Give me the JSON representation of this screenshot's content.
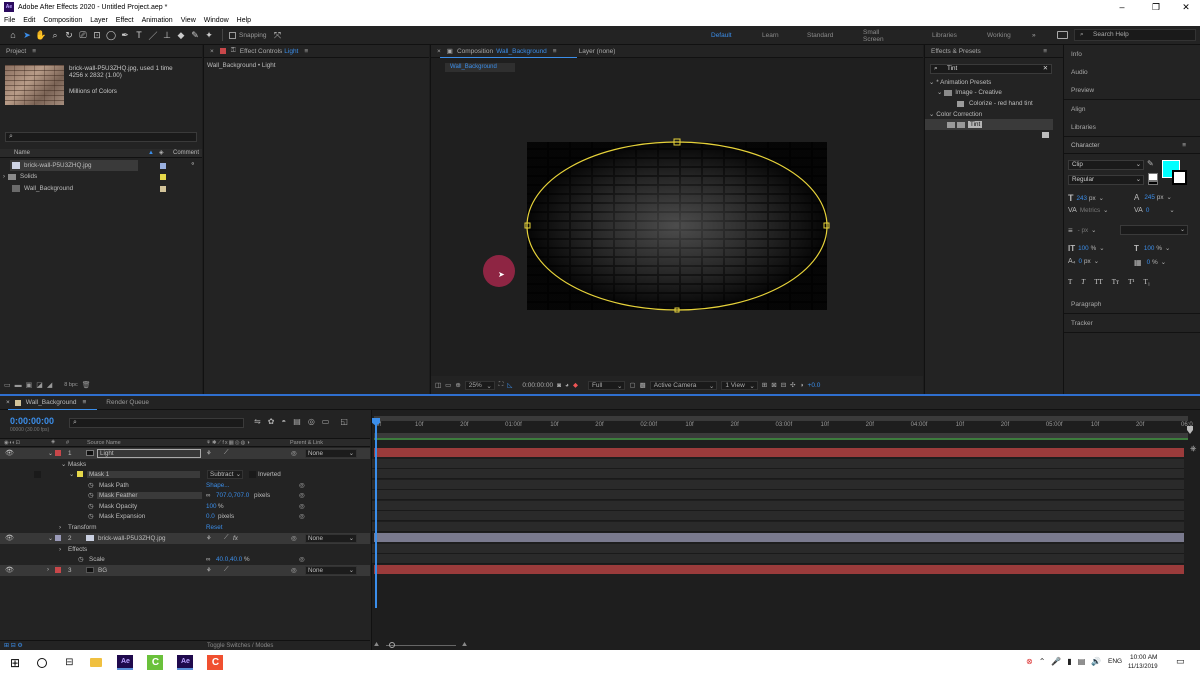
{
  "window": {
    "title": "Adobe After Effects 2020 - Untitled Project.aep *",
    "app_icon": "Ae"
  },
  "menu": [
    "File",
    "Edit",
    "Composition",
    "Layer",
    "Effect",
    "Animation",
    "View",
    "Window",
    "Help"
  ],
  "toolbar": {
    "snapping": "Snapping"
  },
  "workspaces": {
    "items": [
      "Default",
      "Learn",
      "Standard",
      "Small Screen",
      "Libraries",
      "Working"
    ],
    "active": "Default",
    "search_help": "Search Help"
  },
  "project": {
    "title": "Project",
    "thumb_name": "brick-wall-P5U3ZHQ.jpg",
    "thumb_used": ", used 1 time",
    "thumb_dims": "4256 x 2832 (1.00)",
    "thumb_colors": "Millions of Colors",
    "col_name": "Name",
    "col_comment": "Comment",
    "items": [
      {
        "name": "brick-wall-P5U3ZHQ.jpg",
        "color": "#9ab0e0"
      },
      {
        "name": "Solids",
        "color": "#e6d84a"
      },
      {
        "name": "Wall_Background",
        "color": "#d3c49a"
      }
    ],
    "bpc": "8 bpc"
  },
  "effect_controls": {
    "tab_prefix": "Effect Controls",
    "tab_layer": "Light",
    "path": "Wall_Background • Light"
  },
  "composition": {
    "tab_prefix": "Composition",
    "tab_name": "Wall_Background",
    "layer_tab": "Layer (none)",
    "sub_tab": "Wall_Background",
    "zoom": "25%",
    "time": "0:00:00:00",
    "resolution": "Full",
    "camera": "Active Camera",
    "views": "1 View",
    "exposure": "+0.0"
  },
  "effects_presets": {
    "title": "Effects & Presets",
    "search": "Tint",
    "tree": [
      {
        "label": "* Animation Presets",
        "level": 0
      },
      {
        "label": "Image - Creative",
        "level": 1
      },
      {
        "label": "Colorize - red hand tint",
        "level": 2
      },
      {
        "label": "Color Correction",
        "level": 0
      },
      {
        "label": "Tint",
        "level": 1
      }
    ]
  },
  "right_panels": {
    "info": "Info",
    "audio": "Audio",
    "preview": "Preview",
    "align": "Align",
    "libraries": "Libraries",
    "paragraph": "Paragraph",
    "tracker": "Tracker"
  },
  "character": {
    "title": "Character",
    "font": "Clip",
    "style": "Regular",
    "size": "243",
    "size_unit": "px",
    "leading": "245",
    "leading_unit": "px",
    "kerning": "Metrics",
    "tracking": "0",
    "stroke": "- px",
    "vscale": "100",
    "hscale": "100",
    "percent": "%",
    "baseline": "0",
    "baseline_unit": "px",
    "tsume": "0",
    "fill_color": "#00ffff",
    "format_buttons": [
      "T",
      "T",
      "TT",
      "Tт",
      "T¹",
      "T₁"
    ]
  },
  "timeline": {
    "comp_tab": "Wall_Background",
    "render_queue": "Render Queue",
    "time": "0:00:00:00",
    "time_sub": "00000 (30.00 fps)",
    "col_source": "Source Name",
    "col_parent": "Parent & Link",
    "toggle": "Toggle Switches / Modes",
    "ruler": [
      "0f",
      "10f",
      "20f",
      "01:00f",
      "10f",
      "20f",
      "02:00f",
      "10f",
      "20f",
      "03:00f",
      "10f",
      "20f",
      "04:00f",
      "10f",
      "20f",
      "05:00f",
      "10f",
      "20f",
      "06:0"
    ],
    "layers": [
      {
        "num": "1",
        "name": "Light",
        "color": "#c8474a",
        "bar": "#9b3b3b",
        "parent": "None"
      },
      {
        "num": "2",
        "name": "brick-wall-P5U3ZHQ.jpg",
        "color": "#9a9ab8",
        "bar": "#7a7a8e",
        "parent": "None"
      },
      {
        "num": "3",
        "name": "BG",
        "color": "#c8474a",
        "bar": "#9b3b3b",
        "parent": "None"
      }
    ],
    "masks_label": "Masks",
    "mask1": "Mask 1",
    "mask_mode": "Subtract",
    "inverted": "Inverted",
    "mask_path": "Mask Path",
    "mask_path_val": "Shape...",
    "mask_feather": "Mask Feather",
    "mask_feather_val": "707.0,707.0",
    "pixels": "pixels",
    "mask_opacity": "Mask Opacity",
    "mask_opacity_val": "100",
    "mask_expansion": "Mask Expansion",
    "mask_expansion_val": "0.0",
    "transform": "Transform",
    "reset": "Reset",
    "effects": "Effects",
    "scale": "Scale",
    "scale_val": "40.0,40.0",
    "pct": "%"
  },
  "taskbar": {
    "time": "10:00 AM",
    "date": "11/13/2019",
    "lang": "ENG"
  }
}
